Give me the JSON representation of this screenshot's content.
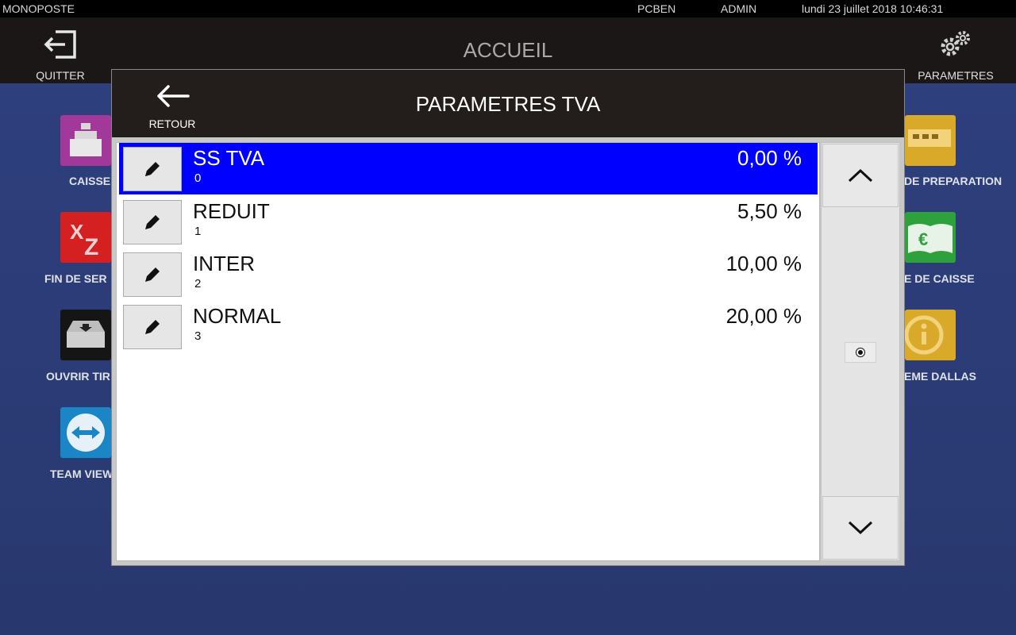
{
  "statusbar": {
    "mode": "MONOPOSTE",
    "host": "PCBEN",
    "user": "ADMIN",
    "datetime": "lundi 23 juillet 2018  10:46:31"
  },
  "header": {
    "title": "ACCUEIL",
    "quit_label": "QUITTER",
    "quit_icon": "exit-icon",
    "params_label": "PARAMETRES",
    "params_icon": "gears-icon"
  },
  "desktop": {
    "left_tiles": [
      {
        "label": "CAISSE",
        "icon": "cash-register-icon"
      },
      {
        "label": "FIN DE SER",
        "icon": "xz-icon"
      },
      {
        "label": "OUVRIR TIR",
        "icon": "drawer-icon"
      },
      {
        "label": "TEAM VIEW",
        "icon": "teamviewer-icon"
      }
    ],
    "right_tiles": [
      {
        "label": "DE PREPARATION",
        "icon": "printer-icon"
      },
      {
        "label": "E DE CAISSE",
        "icon": "euro-book-icon"
      },
      {
        "label": "EME DALLAS",
        "icon": "info-icon"
      }
    ]
  },
  "dialog": {
    "title": "PARAMETRES TVA",
    "back_label": "RETOUR",
    "rows": [
      {
        "name": "SS TVA",
        "code": "0",
        "rate": "0,00 %",
        "selected": true
      },
      {
        "name": "REDUIT",
        "code": "1",
        "rate": "5,50 %",
        "selected": false
      },
      {
        "name": "INTER",
        "code": "2",
        "rate": "10,00 %",
        "selected": false
      },
      {
        "name": "NORMAL",
        "code": "3",
        "rate": "20,00 %",
        "selected": false
      }
    ]
  },
  "colors": {
    "selected_row": "#0000ff",
    "desktop_bg": "#2b3f78",
    "header_bg": "#1a1716"
  }
}
